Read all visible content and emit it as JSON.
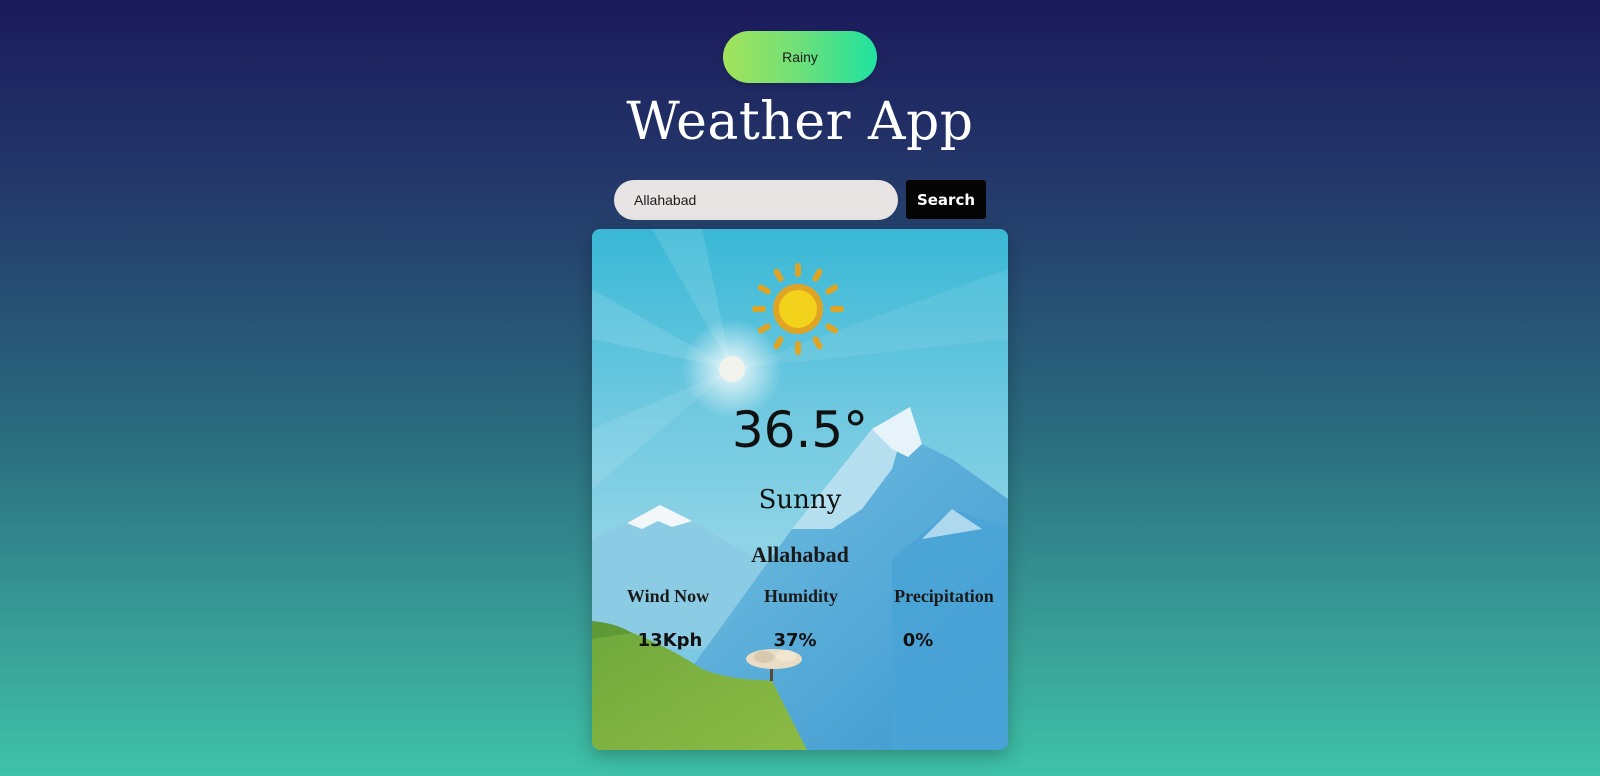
{
  "mode_toggle": {
    "label": "Rainy"
  },
  "header": {
    "title": "Weather App"
  },
  "search": {
    "value": "Allahabad",
    "button_label": "Search"
  },
  "weather": {
    "icon": "sun-icon",
    "temperature": "36.5°",
    "condition": "Sunny",
    "city": "Allahabad",
    "stats": [
      {
        "label": "Wind Now",
        "value": "13Kph"
      },
      {
        "label": "Humidity",
        "value": "37%"
      },
      {
        "label": "Precipitation",
        "value": "0%"
      }
    ]
  },
  "colors": {
    "search_button": "#050505",
    "toggle_gradient_start": "#a3e35a",
    "toggle_gradient_end": "#1ee2a0"
  }
}
